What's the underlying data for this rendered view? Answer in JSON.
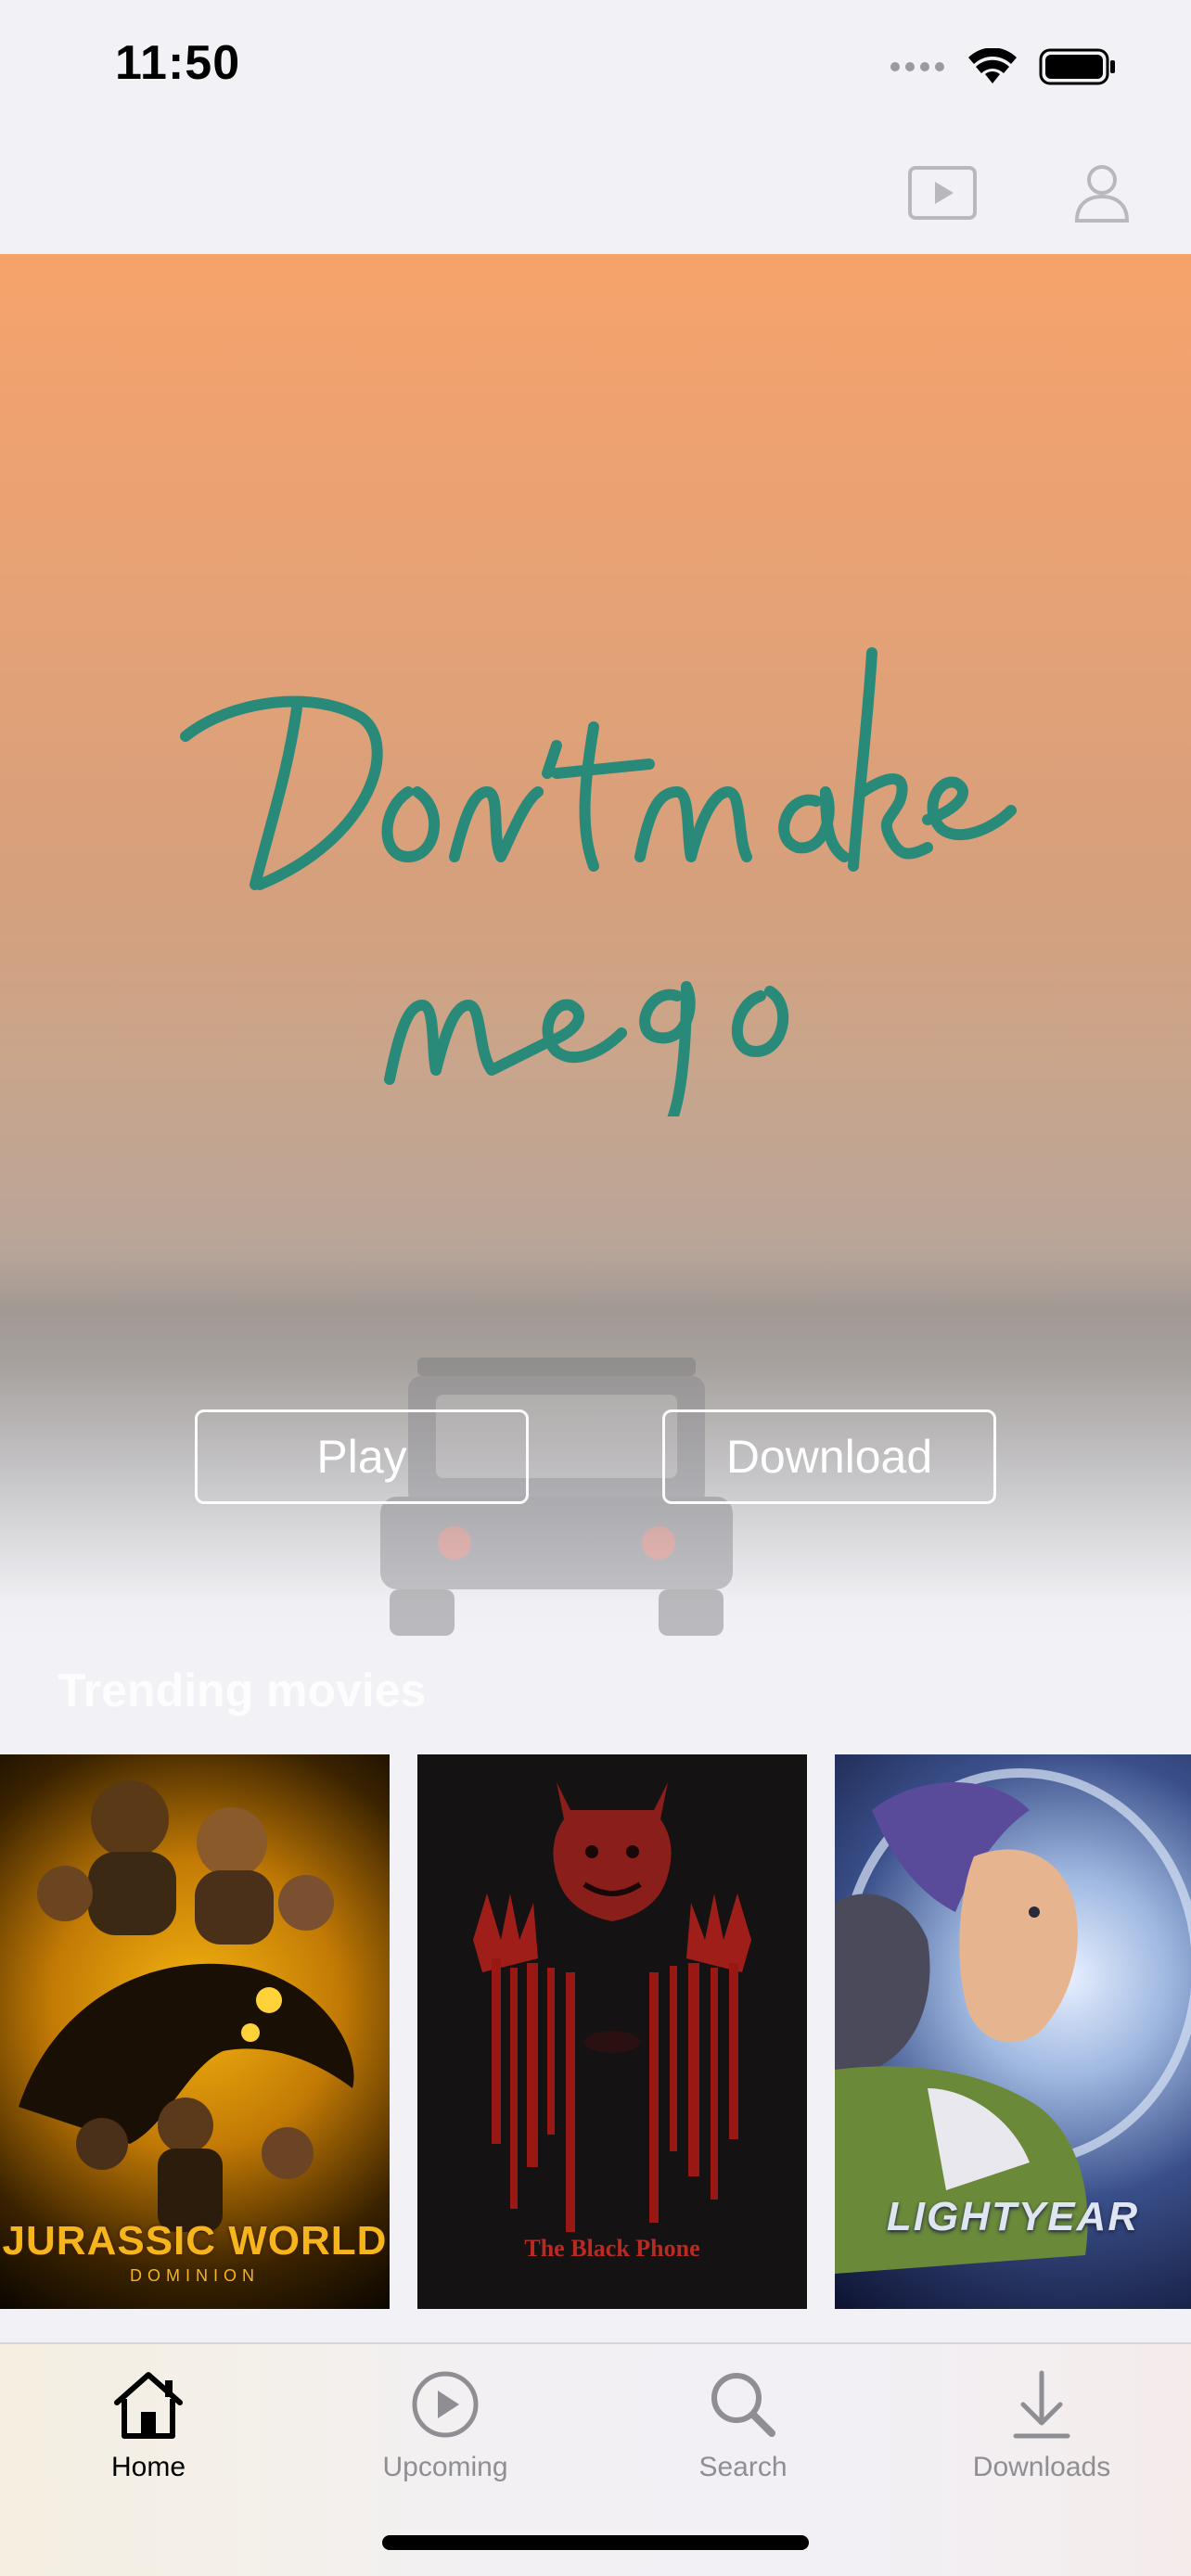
{
  "status_bar": {
    "time": "11:50",
    "icons": [
      "signal-dots-icon",
      "wifi-icon",
      "battery-icon"
    ]
  },
  "nav_bar": {
    "icons": [
      "play-rectangle-icon",
      "person-icon"
    ]
  },
  "hero": {
    "title_art_text": "Don't make me go",
    "play_label": "Play",
    "download_label": "Download"
  },
  "trending": {
    "title": "Trending movies",
    "posters": [
      {
        "caption": "JURASSIC WORLD",
        "subcaption": "DOMINION"
      },
      {
        "caption": "The Black Phone"
      },
      {
        "caption": "LIGHTYEAR"
      }
    ]
  },
  "tab_bar": {
    "tabs": [
      {
        "label": "Home",
        "icon": "house-icon",
        "active": true
      },
      {
        "label": "Upcoming",
        "icon": "play-circle-icon",
        "active": false
      },
      {
        "label": "Search",
        "icon": "magnifying-glass-icon",
        "active": false
      },
      {
        "label": "Downloads",
        "icon": "download-arrow-icon",
        "active": false
      }
    ]
  },
  "colors": {
    "background": "#f2f1f6",
    "hero_top": "#f6a36a",
    "title_art": "#2a8a7a",
    "tab_inactive": "#8e8e93",
    "tab_active": "#000000"
  }
}
